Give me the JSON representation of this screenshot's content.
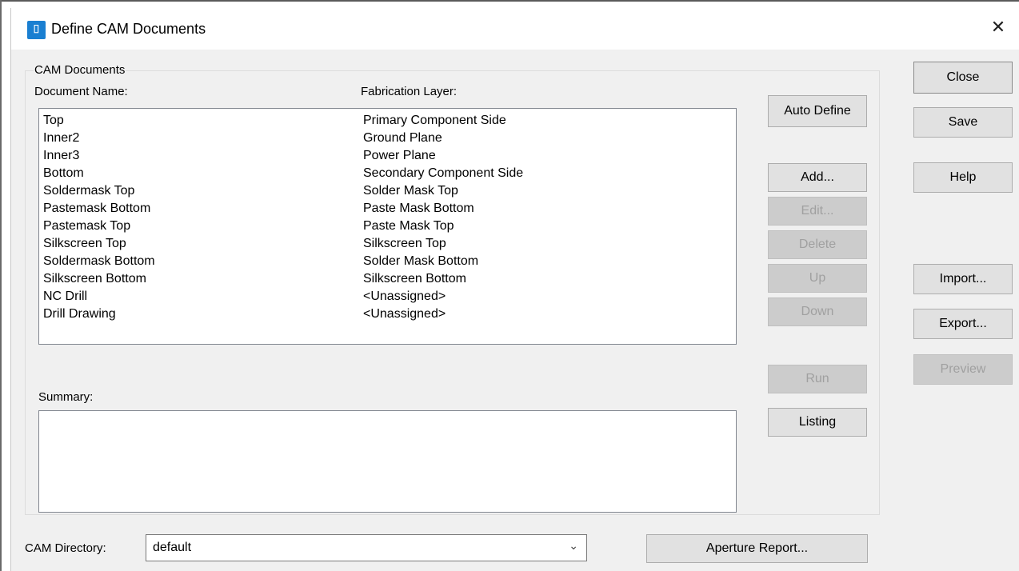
{
  "window": {
    "title": "Define CAM Documents",
    "icon": "app-icon",
    "close_glyph": "✕"
  },
  "group": {
    "legend": "CAM Documents",
    "doc_name_label": "Document Name:",
    "fab_layer_label": "Fabrication Layer:"
  },
  "documents": [
    {
      "name": "Top",
      "layer": "Primary Component Side"
    },
    {
      "name": "Inner2",
      "layer": "Ground Plane"
    },
    {
      "name": "Inner3",
      "layer": "Power Plane"
    },
    {
      "name": "Bottom",
      "layer": "Secondary Component Side"
    },
    {
      "name": "Soldermask Top",
      "layer": "Solder Mask Top"
    },
    {
      "name": "Pastemask Bottom",
      "layer": "Paste Mask Bottom"
    },
    {
      "name": "Pastemask Top",
      "layer": "Paste Mask Top"
    },
    {
      "name": "Silkscreen Top",
      "layer": "Silkscreen Top"
    },
    {
      "name": "Soldermask Bottom",
      "layer": "Solder Mask Bottom"
    },
    {
      "name": "Silkscreen Bottom",
      "layer": "Silkscreen Bottom"
    },
    {
      "name": "NC Drill",
      "layer": "<Unassigned>"
    },
    {
      "name": "Drill Drawing",
      "layer": "<Unassigned>"
    }
  ],
  "summary": {
    "label": "Summary:",
    "text": ""
  },
  "buttons": {
    "auto_define": "Auto Define",
    "add": "Add...",
    "edit": "Edit...",
    "delete": "Delete",
    "up": "Up",
    "down": "Down",
    "run": "Run",
    "listing": "Listing",
    "close": "Close",
    "save": "Save",
    "help": "Help",
    "import": "Import...",
    "export": "Export...",
    "preview": "Preview",
    "aperture_report": "Aperture Report..."
  },
  "cam_directory": {
    "label": "CAM Directory:",
    "value": "default",
    "arrow": "⌄"
  },
  "colors": {
    "dialog_bg": "#f0f0f0",
    "button_bg": "#e1e1e1",
    "disabled_text": "#a0a0a0",
    "icon_blue": "#1a7fd1"
  }
}
